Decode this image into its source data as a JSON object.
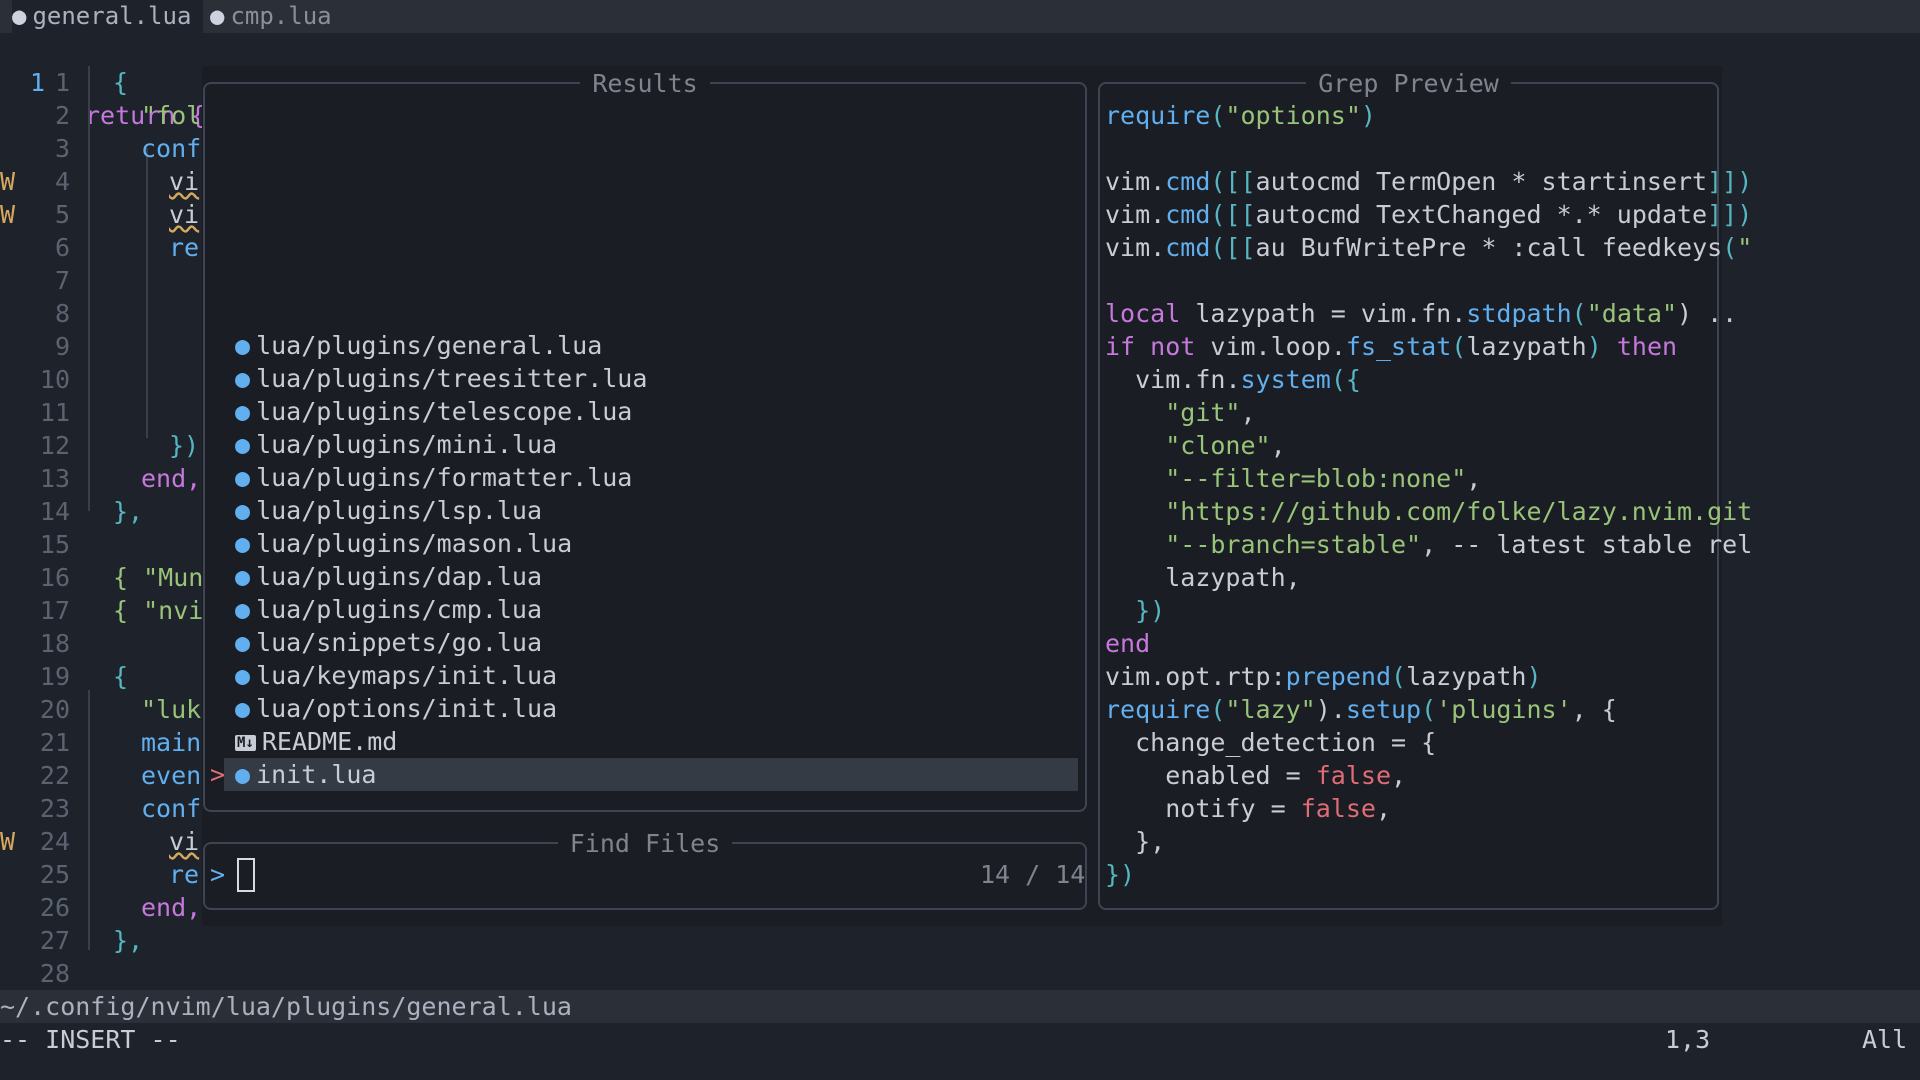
{
  "tabs": [
    {
      "icon": "lua-icon",
      "label": "general.lua"
    },
    {
      "icon": "lua-icon",
      "label": "cmp.lua"
    }
  ],
  "editor": {
    "current_line": "1",
    "lines": [
      {
        "n": "1",
        "sign": "",
        "code": "{"
      },
      {
        "n": "2",
        "sign": "",
        "code": "\"fol"
      },
      {
        "n": "3",
        "sign": "",
        "code": "conf"
      },
      {
        "n": "4",
        "sign": "W",
        "code": "vi"
      },
      {
        "n": "5",
        "sign": "W",
        "code": "vi"
      },
      {
        "n": "6",
        "sign": "",
        "code": "re"
      },
      {
        "n": "7",
        "sign": "",
        "code": ""
      },
      {
        "n": "8",
        "sign": "",
        "code": ""
      },
      {
        "n": "9",
        "sign": "",
        "code": ""
      },
      {
        "n": "10",
        "sign": "",
        "code": ""
      },
      {
        "n": "11",
        "sign": "",
        "code": ""
      },
      {
        "n": "12",
        "sign": "",
        "code": "})"
      },
      {
        "n": "13",
        "sign": "",
        "code": "end,"
      },
      {
        "n": "14",
        "sign": "",
        "code": "},"
      },
      {
        "n": "15",
        "sign": "",
        "code": ""
      },
      {
        "n": "16",
        "sign": "",
        "code": "{ \"Mun"
      },
      {
        "n": "17",
        "sign": "",
        "code": "{ \"nvi"
      },
      {
        "n": "18",
        "sign": "",
        "code": ""
      },
      {
        "n": "19",
        "sign": "",
        "code": "{"
      },
      {
        "n": "20",
        "sign": "",
        "code": "\"luk"
      },
      {
        "n": "21",
        "sign": "",
        "code": "main"
      },
      {
        "n": "22",
        "sign": "",
        "code": "even"
      },
      {
        "n": "23",
        "sign": "",
        "code": "conf"
      },
      {
        "n": "24",
        "sign": "W",
        "code": "vi"
      },
      {
        "n": "25",
        "sign": "",
        "code": "re"
      },
      {
        "n": "26",
        "sign": "",
        "code": "end,"
      },
      {
        "n": "27",
        "sign": "",
        "code": "},"
      },
      {
        "n": "28",
        "sign": "",
        "code": ""
      }
    ],
    "first_line": "return {"
  },
  "telescope": {
    "results_title": "Results",
    "prompt_title": "Find Files",
    "preview_title": "Grep Preview",
    "prompt_prefix": ">",
    "selection_caret": ">",
    "count": "14 / 14",
    "results": [
      {
        "icon": "lua-icon",
        "path": "lua/plugins/general.lua"
      },
      {
        "icon": "lua-icon",
        "path": "lua/plugins/treesitter.lua"
      },
      {
        "icon": "lua-icon",
        "path": "lua/plugins/telescope.lua"
      },
      {
        "icon": "lua-icon",
        "path": "lua/plugins/mini.lua"
      },
      {
        "icon": "lua-icon",
        "path": "lua/plugins/formatter.lua"
      },
      {
        "icon": "lua-icon",
        "path": "lua/plugins/lsp.lua"
      },
      {
        "icon": "lua-icon",
        "path": "lua/plugins/mason.lua"
      },
      {
        "icon": "lua-icon",
        "path": "lua/plugins/dap.lua"
      },
      {
        "icon": "lua-icon",
        "path": "lua/plugins/cmp.lua"
      },
      {
        "icon": "lua-icon",
        "path": "lua/snippets/go.lua"
      },
      {
        "icon": "lua-icon",
        "path": "lua/keymaps/init.lua"
      },
      {
        "icon": "lua-icon",
        "path": "lua/options/init.lua"
      },
      {
        "icon": "markdown-icon",
        "path": "README.md"
      },
      {
        "icon": "lua-icon",
        "path": "init.lua"
      }
    ],
    "preview_lines": [
      "require(\"options\")",
      "",
      "vim.cmd([[autocmd TermOpen * startinsert]])",
      "vim.cmd([[autocmd TextChanged *.* update]])",
      "vim.cmd([[au BufWritePre * :call feedkeys(\"",
      "",
      "local lazypath = vim.fn.stdpath(\"data\") ..",
      "if not vim.loop.fs_stat(lazypath) then",
      "  vim.fn.system({",
      "    \"git\",",
      "    \"clone\",",
      "    \"--filter=blob:none\",",
      "    \"https://github.com/folke/lazy.nvim.git",
      "    \"--branch=stable\", -- latest stable rel",
      "    lazypath,",
      "  })",
      "end",
      "vim.opt.rtp:prepend(lazypath)",
      "require(\"lazy\").setup('plugins', {",
      "  change_detection = {",
      "    enabled = false,",
      "    notify = false,",
      "  },",
      "})"
    ]
  },
  "statusline": {
    "path": "~/.config/nvim/lua/plugins/general.lua"
  },
  "cmdline": {
    "mode": "-- INSERT --",
    "position": "1,3",
    "percent": "All"
  }
}
